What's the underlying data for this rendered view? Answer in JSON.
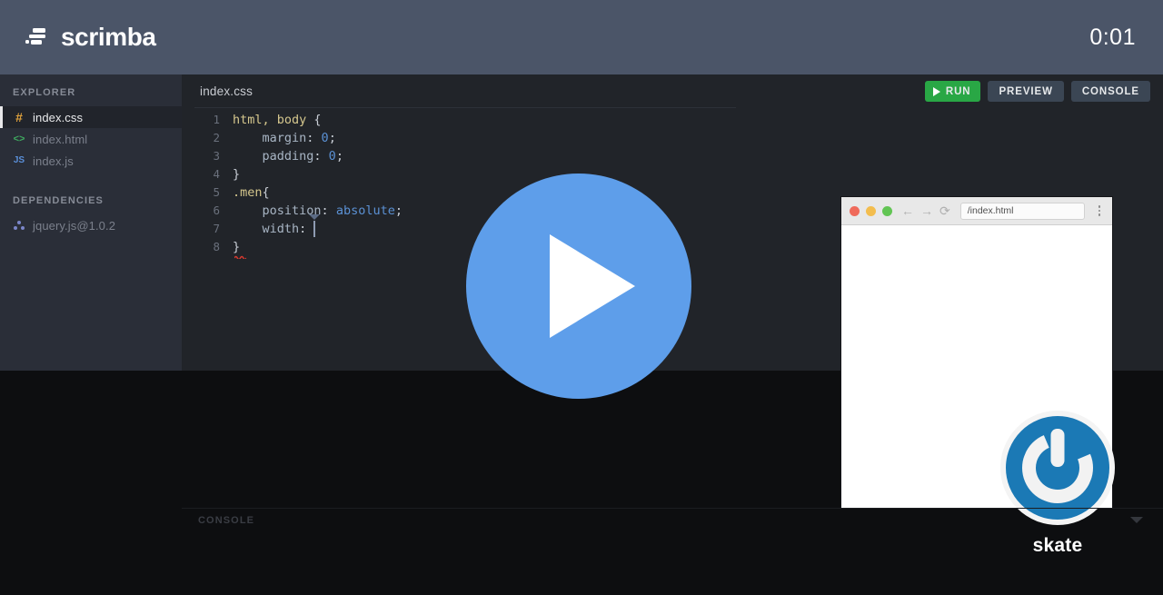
{
  "header": {
    "brand_name": "scrimba",
    "logo_icon": "scrimba-speedlines-icon",
    "timer": "0:01"
  },
  "sidebar": {
    "explorer_title": "EXPLORER",
    "dependencies_title": "DEPENDENCIES",
    "files": [
      {
        "name": "index.css",
        "icon": "hash-icon",
        "active": true
      },
      {
        "name": "index.html",
        "icon": "angle-brackets-icon",
        "active": false
      },
      {
        "name": "index.js",
        "icon": "js-icon",
        "active": false
      }
    ],
    "dependencies": [
      {
        "name": "jquery.js@1.0.2",
        "icon": "node-tree-icon"
      }
    ]
  },
  "editor": {
    "tab_label": "index.css",
    "actions": {
      "run_label": "RUN",
      "preview_label": "PREVIEW",
      "console_label": "CONSOLE"
    },
    "lines": [
      {
        "n": "1",
        "selector": "html, body",
        "text": " {"
      },
      {
        "n": "2",
        "prop": "    margin",
        "colon": ": ",
        "value": "0",
        "semi": ";"
      },
      {
        "n": "3",
        "prop": "    padding",
        "colon": ": ",
        "value": "0",
        "semi": ";"
      },
      {
        "n": "4",
        "text": "}"
      },
      {
        "n": "5",
        "selector": ".men",
        "text": "{"
      },
      {
        "n": "6",
        "prop": "    position",
        "colon": ": ",
        "value": "absolute",
        "semi": ";"
      },
      {
        "n": "7",
        "prop": "    width",
        "colon": ": ",
        "value": "",
        "semi": ""
      },
      {
        "n": "8",
        "text": "}"
      }
    ]
  },
  "console_panel": {
    "label": "CONSOLE",
    "collapse_icon": "chevron-down-icon"
  },
  "preview": {
    "url": "/index.html",
    "traffic_lights": [
      "close-dot",
      "minimize-dot",
      "maximize-dot"
    ],
    "back_icon": "arrow-left-icon",
    "forward_icon": "arrow-right-icon",
    "reload_icon": "reload-icon",
    "menu_icon": "kebab-menu-icon"
  },
  "skate_badge": {
    "label": "skate",
    "logo_icon": "power-button-icon"
  },
  "play_overlay": {
    "icon": "play-triangle-icon"
  },
  "colors": {
    "header_bg": "#4b5568",
    "sidebar_bg": "#2a2e38",
    "editor_bg": "#212429",
    "stage_bg": "#0d0e10",
    "run_green": "#29a745",
    "button_slate": "#3b4654",
    "play_blue": "#5e9eea",
    "skate_blue": "#1b79b5",
    "syntax_selector": "#d6c88e",
    "syntax_property": "#a8b5c4",
    "syntax_value": "#5b91d4",
    "error_underline": "#d7392f"
  }
}
